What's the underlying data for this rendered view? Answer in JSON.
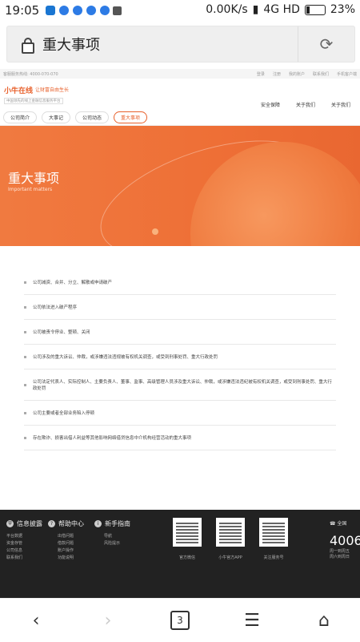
{
  "status_bar": {
    "time": "19:05",
    "speed": "0.00K/s",
    "network": "4G HD",
    "battery": "23%"
  },
  "browser": {
    "title": "重大事项",
    "reload_icon": "reload-icon"
  },
  "site": {
    "topbar_left": "客服服务热线: 4000-070-070",
    "topbar_links": [
      "登录",
      "注册",
      "我的账户",
      "联系我们",
      "手机客户端"
    ],
    "logo": "小牛在线",
    "slogan": "让财富自由生长",
    "logo_sub": "中国领先的线上金融信息服务平台",
    "main_nav": [
      "安全保障",
      "关于我们",
      "关于我们"
    ],
    "sub_tabs": [
      {
        "label": "公司简介",
        "active": false
      },
      {
        "label": "大事记",
        "active": false
      },
      {
        "label": "公司动态",
        "active": false
      },
      {
        "label": "重大事项",
        "active": true
      }
    ]
  },
  "banner": {
    "title": "重大事项",
    "subtitle": "Important matters"
  },
  "events": [
    "公司减资、合并、分立、解散或申请破产",
    "公司依法进入破产程序",
    "公司被责令停业、整顿、关闭",
    "公司涉及的重大诉讼、仲裁，或涉嫌违法违规被有权机关调查，或受到刑事处罚、重大行政处罚",
    "公司法定代表人、实际控制人、主要负责人、董事、监事、高级管理人员涉及重大诉讼、仲裁，或涉嫌违法违纪被有权机关调查，或受到刑事处罚、重大行政处罚",
    "公司主要或者全部业务陷入停顿",
    "存在欺诈、损害出借人利益等其他影响网络借贷信息中介机构经营活动的重大事项"
  ],
  "footer": {
    "cols": [
      {
        "head": "信息披露",
        "icon": "shield-icon",
        "items": [
          "平台数据",
          "资金存管",
          "公司信息",
          "联系我们"
        ]
      },
      {
        "head": "帮助中心",
        "icon": "question-icon",
        "items": [
          "出借问题",
          "借款问题",
          "账户操作",
          "功能说明"
        ]
      },
      {
        "head": "新手指南",
        "icon": "info-icon",
        "items": [
          "导航",
          "风险提示"
        ]
      }
    ],
    "qrs": [
      "官方微信",
      "小牛官方APP",
      "关注服务号"
    ],
    "phone_label": "全国",
    "phone_num": "4006",
    "phone_sub": [
      "周一到周五",
      "周六到周日"
    ]
  },
  "nav": {
    "tab_count": "3"
  }
}
